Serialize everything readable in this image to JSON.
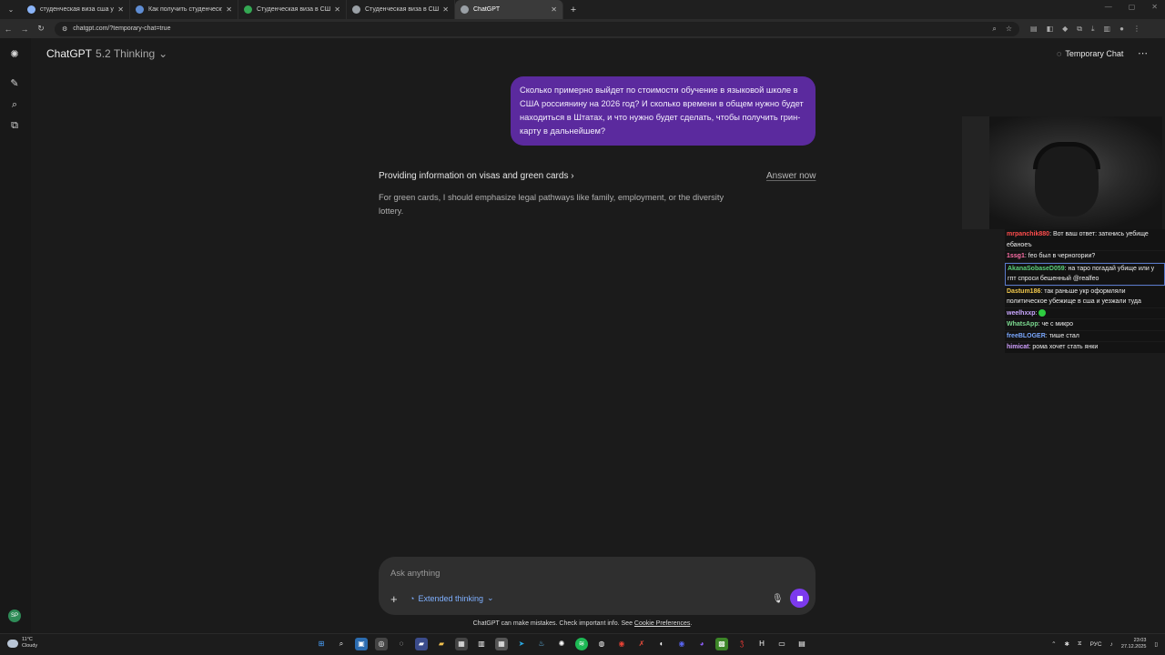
{
  "browser": {
    "tabs": [
      {
        "title": "студенческая виза сша учитс",
        "favicon_color": "#8ab4f8",
        "active": false
      },
      {
        "title": "Как получить студенческую в",
        "favicon_color": "#5f8dd3",
        "active": false
      },
      {
        "title": "Студенческая виза в США - в",
        "favicon_color": "#34a853",
        "active": false
      },
      {
        "title": "Студенческая виза в США: сш",
        "favicon_color": "#9aa0a6",
        "active": false
      },
      {
        "title": "ChatGPT",
        "favicon_color": "#9aa0a6",
        "active": true
      }
    ],
    "url": "chatgpt.com/?temporary-chat=true"
  },
  "header": {
    "model_name": "ChatGPT",
    "model_version": "5.2 Thinking",
    "temporary_chat_label": "Temporary Chat"
  },
  "chat": {
    "user_message": "Сколько примерно выйдет по стоимости обучение в языковой школе в США россиянину на 2026 год? И сколько времени в общем нужно будет находиться в Штатах, и что нужно будет сделать, чтобы получить грин-карту в дальнейшем?",
    "thinking_title": "Providing information on visas and green cards",
    "answer_now_label": "Answer now",
    "thinking_body": "For green cards, I should emphasize legal pathways like family, employment, or the diversity lottery."
  },
  "composer": {
    "placeholder": "Ask anything",
    "mode_label": "Extended thinking"
  },
  "disclaimer": {
    "text": "ChatGPT can make mistakes. Check important info. See",
    "link": "Cookie Preferences",
    "end": "."
  },
  "stream_chat": [
    {
      "user": "mrpanchik880",
      "color": "#ff4d4d",
      "text": "Вот ваш ответ: заткнись уебище ебаноеъ",
      "highlight": false
    },
    {
      "user": "1ssg1",
      "color": "#ff6fa8",
      "text": "feo был в черногории?",
      "highlight": false
    },
    {
      "user": "AkanaSobaseD059",
      "color": "#5ad17a",
      "text": "на таро погадай убище или у гпт спроси бешенный @realfeo",
      "highlight": true
    },
    {
      "user": "Dastum186",
      "color": "#f2c94c",
      "text": "так раньше укр оформляли политическое убежище в сша и уезжали туда",
      "highlight": false
    },
    {
      "user": "weelhxxp",
      "color": "#c9a7ff",
      "text": "",
      "emote": true,
      "highlight": false
    },
    {
      "user": "WhatsApp",
      "color": "#7bd88f",
      "text": "че с микро",
      "highlight": false
    },
    {
      "user": "freeBLOGER",
      "color": "#7aa8ff",
      "text": "тише стал",
      "highlight": false
    },
    {
      "user": "himicat",
      "color": "#d0a0ff",
      "text": "рома хочет стать янки",
      "highlight": false
    }
  ],
  "taskbar": {
    "weather_temp": "11°C",
    "weather_desc": "Cloudy",
    "lang": "РУС",
    "time": "23:03",
    "date": "27.12.2025"
  },
  "colors": {
    "user_bubble": "#5b2a9e",
    "accent_purple": "#7c3aed",
    "link_blue": "#7fb0ff"
  }
}
